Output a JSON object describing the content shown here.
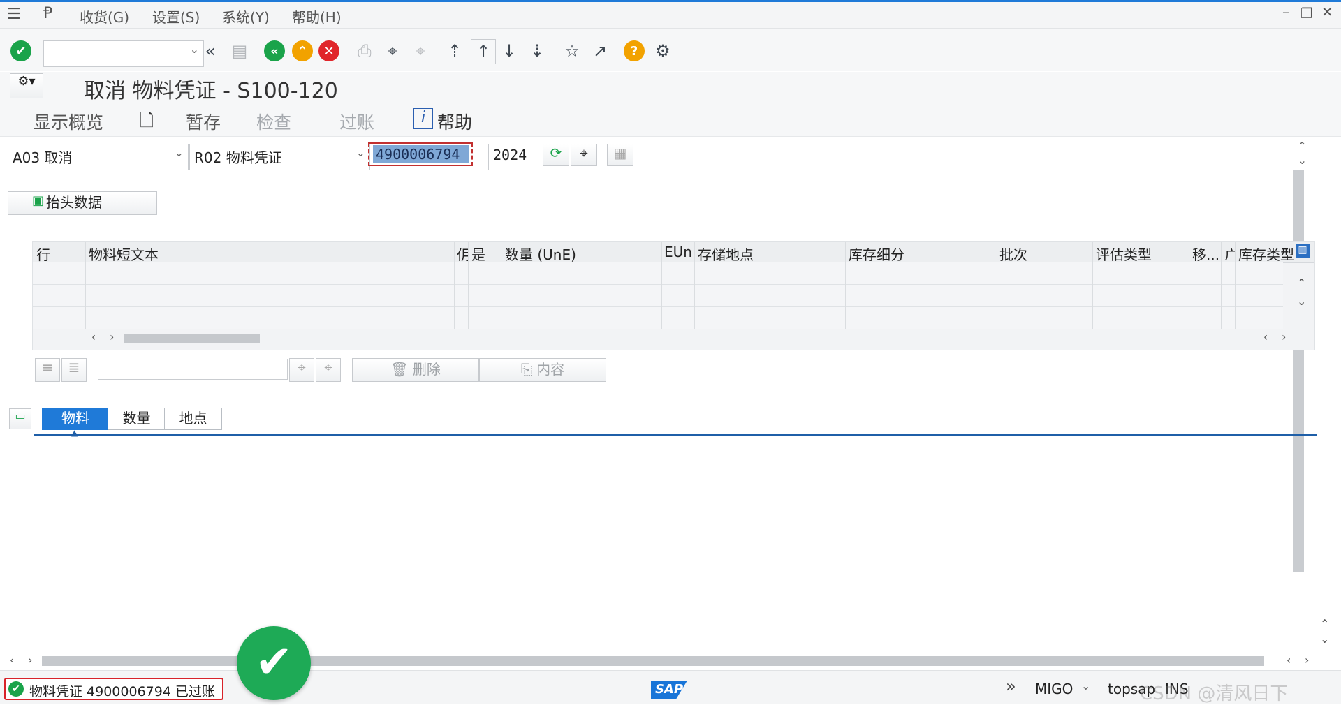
{
  "menu": {
    "items": [
      "收货(G)",
      "设置(S)",
      "系统(Y)",
      "帮助(H)"
    ]
  },
  "title": "取消 物料凭证 - S100-120",
  "appbar": {
    "overview": "显示概览",
    "hold": "暂存",
    "check": "检查",
    "post": "过账",
    "help": "帮助"
  },
  "header": {
    "action_select": "A03 取消",
    "reference_select": "R02 物料凭证",
    "document_number": "4900006794",
    "year": "2024"
  },
  "header_data_button": "抬头数据",
  "grid": {
    "columns": [
      "行",
      "物料短文本",
      "仴",
      "是",
      "数量 (UnE)",
      "EUn",
      "存储地点",
      "库存细分",
      "批次",
      "评估类型",
      "移...",
      "ㄬ",
      "库存类型"
    ]
  },
  "grid_toolbar": {
    "delete": "删除",
    "content": "内容"
  },
  "tabs": [
    "物料",
    "数量",
    "地点"
  ],
  "status": {
    "message": "物料凭证 4900006794 已过账",
    "transaction": "MIGO",
    "system": "topsap",
    "mode": "INS",
    "logo": "SAP",
    "watermark": "CSDN @清风日下"
  },
  "colors": {
    "accent": "#1f7ad8",
    "success": "#1aa34a",
    "error": "#e0262b",
    "warning": "#f2a200",
    "sapblue": "#1875d8"
  }
}
